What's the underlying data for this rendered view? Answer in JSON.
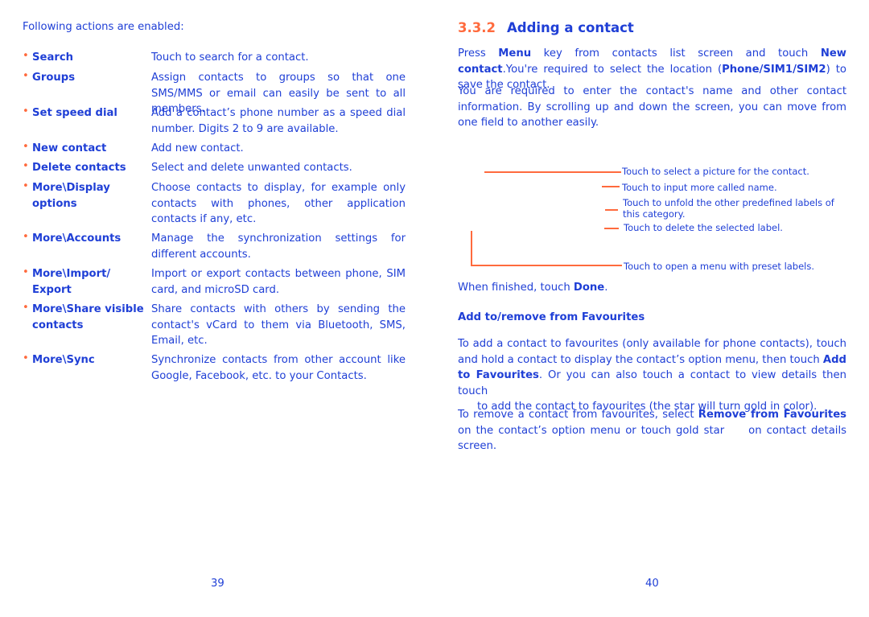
{
  "left": {
    "intro": "Following actions are enabled:",
    "items": [
      {
        "label": "Search",
        "desc": "Touch to search for a contact."
      },
      {
        "label": "Groups",
        "desc": "Assign contacts to groups so that one SMS/MMS or email can easily be sent to all members."
      },
      {
        "label": "Set speed dial",
        "desc": "Add a contact’s phone number as a speed dial number.  Digits 2 to 9 are available."
      },
      {
        "label": "New contact",
        "desc": "Add new contact."
      },
      {
        "label": "Delete contacts",
        "desc": "Select and delete unwanted contacts."
      },
      {
        "label": "More\\Display options",
        "desc": "Choose contacts to display, for example only contacts with phones, other application contacts if any, etc."
      },
      {
        "label": "More\\Accounts",
        "desc": "Manage the synchronization settings for different accounts."
      },
      {
        "label": "More\\Import/ Export",
        "desc": "Import or export contacts between phone, SIM card, and microSD card."
      },
      {
        "label": "More\\Share visible contacts",
        "desc": "Share contacts with others by sending the contact's vCard to them via Bluetooth, SMS, Email, etc."
      },
      {
        "label": "More\\Sync",
        "desc": "Synchronize contacts from other account like Google, Facebook, etc. to your Contacts."
      }
    ],
    "page_number": "39"
  },
  "right": {
    "section_number": "3.3.2",
    "section_title": "Adding a contact",
    "p1": {
      "a": "Press ",
      "b1": "Menu",
      "c": " key from contacts list screen and touch ",
      "b2": "New contact",
      "d": ".You're required to select the location (",
      "b3": "Phone/SIM1/SIM2",
      "e": ") to save the contact."
    },
    "p2": "You are required to enter the contact's name and other contact information. By scrolling up and down the screen, you can move from one field to another easily.",
    "callouts": [
      "Touch to select a picture for the contact.",
      "Touch to input more called name.",
      "Touch to unfold the other predefined labels of this category.",
      "Touch to delete the selected label.",
      "Touch to open a menu with preset labels."
    ],
    "done": {
      "a": "When finished, touch ",
      "b": "Done",
      "c": "."
    },
    "subheading": "Add to/remove from Favourites",
    "p3": {
      "a": "To add a contact to favourites (only available for phone contacts), touch and hold a contact to display the contact’s option menu, then touch ",
      "b1": "Add to Favourites",
      "c": ". Or you can also touch a contact to view details then touch",
      "d": "to add the contact to favourites (the star will turn gold in color)."
    },
    "p4": {
      "a": "To remove a contact from favourites, select ",
      "b": "Remove from Favourites",
      "c": " on the contact’s option menu or touch gold star",
      "d": "on contact details screen."
    },
    "page_number": "40"
  },
  "colors": {
    "text": "#1f3fd6",
    "accent": "#ff6a3d"
  }
}
